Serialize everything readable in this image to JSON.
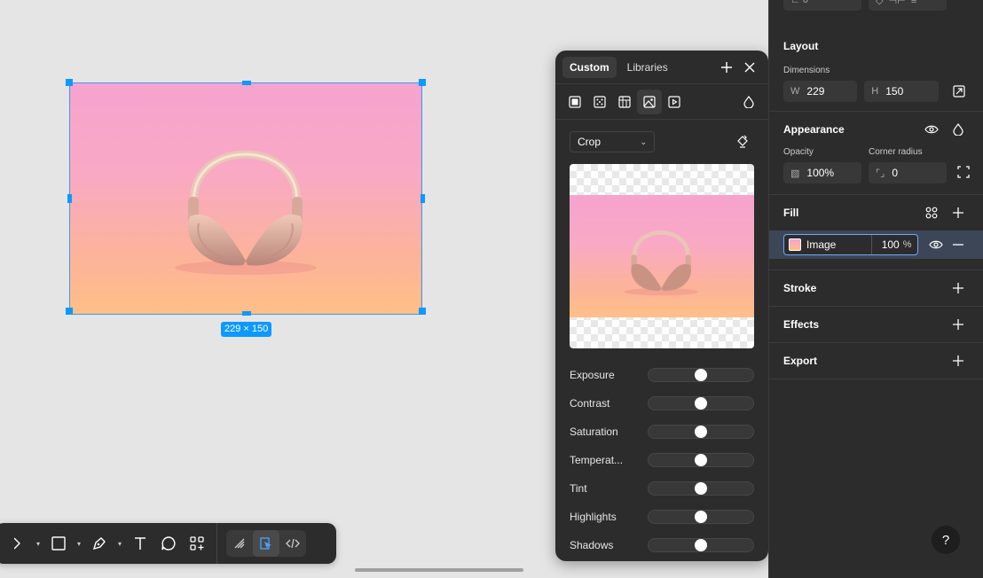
{
  "canvas": {
    "selection_size_label": "229 × 150"
  },
  "toolbar": {
    "tools": [
      "move-tool",
      "frame-tool",
      "pen-tool",
      "text-tool",
      "comment-tool",
      "actions-tool"
    ],
    "modes": [
      "draw-mode",
      "design-mode",
      "dev-mode"
    ]
  },
  "fill_picker": {
    "tabs": [
      {
        "label": "Custom",
        "active": true
      },
      {
        "label": "Libraries",
        "active": false
      }
    ],
    "fill_types": [
      "solid",
      "gradient",
      "pattern",
      "image",
      "video"
    ],
    "active_type": "image",
    "scale_mode": "Crop",
    "adjustments": [
      {
        "label": "Exposure",
        "value": 0.5
      },
      {
        "label": "Contrast",
        "value": 0.5
      },
      {
        "label": "Saturation",
        "value": 0.5
      },
      {
        "label": "Temperat...",
        "value": 0.5
      },
      {
        "label": "Tint",
        "value": 0.5
      },
      {
        "label": "Highlights",
        "value": 0.5
      },
      {
        "label": "Shadows",
        "value": 0.5
      }
    ]
  },
  "panel": {
    "top_stub": {
      "rotation": "0°"
    },
    "layout": {
      "title": "Layout",
      "dimensions_label": "Dimensions",
      "w_prefix": "W",
      "w_value": "229",
      "h_prefix": "H",
      "h_value": "150"
    },
    "appearance": {
      "title": "Appearance",
      "opacity_label": "Opacity",
      "opacity_value": "100%",
      "radius_label": "Corner radius",
      "radius_value": "0"
    },
    "fill": {
      "title": "Fill",
      "layer_name": "Image",
      "percent": "100",
      "unit": "%"
    },
    "stroke": {
      "title": "Stroke"
    },
    "effects": {
      "title": "Effects"
    },
    "export": {
      "title": "Export"
    },
    "help_label": "?"
  },
  "colors": {
    "accent": "#0d99ff",
    "panel_bg": "#2c2c2c",
    "canvas_bg": "#e5e5e5",
    "selected_row": "#3d4656"
  }
}
